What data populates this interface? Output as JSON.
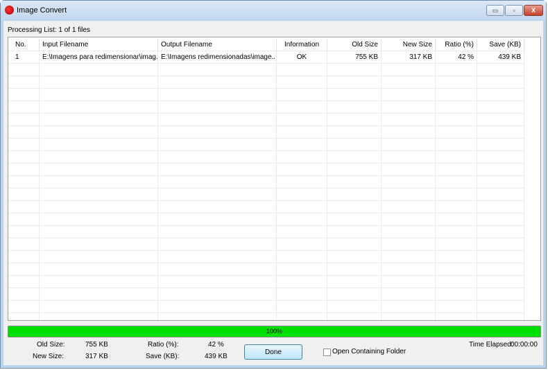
{
  "window": {
    "title": "Image Convert",
    "minimize": "▭",
    "maximize": "▫",
    "close": "X"
  },
  "processing_list": "Processing List: 1 of 1 files",
  "columns": [
    "No.",
    "Input Filename",
    "Output Filename",
    "Information",
    "Old Size",
    "New Size",
    "Ratio (%)",
    "Save (KB)"
  ],
  "rows": [
    [
      "1",
      "E:\\Imagens para redimensionar\\imag...",
      "E:\\Imagens redimensionadas\\image...",
      "OK",
      "755 KB",
      "317 KB",
      "42 %",
      "439 KB"
    ]
  ],
  "progress": {
    "percent": 100,
    "label": "100%"
  },
  "summary": {
    "old_size_label": "Old Size:",
    "old_size": "755 KB",
    "new_size_label": "New Size:",
    "new_size": "317 KB",
    "ratio_label": "Ratio (%):",
    "ratio": "42 %",
    "save_label": "Save (KB):",
    "save": "439 KB",
    "time_label": "Time Elapsed:",
    "time": "00:00:00"
  },
  "done_button": "Done",
  "open_folder": {
    "label": "Open Containing Folder",
    "checked": false
  }
}
